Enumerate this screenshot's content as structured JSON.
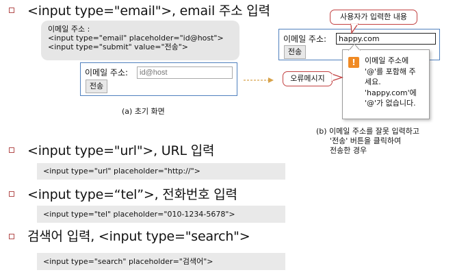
{
  "sections": [
    {
      "heading": "<input type=\"email\">, email 주소 입력"
    },
    {
      "heading": "<input type=\"url\">, URL 입력",
      "code": "<input type=\"url\" placeholder=\"http://\">"
    },
    {
      "heading": "<input type=“tel”>, 전화번호 입력",
      "code": "<input type=\"tel\" placeholder=\"010-1234-5678\">"
    },
    {
      "heading": "검색어 입력, <input type=\"search\">",
      "code": "<input type=\"search\" placeholder=\"검색어\">"
    }
  ],
  "email_code": {
    "lines": [
      "이메일 주소 :",
      "<input type=\"email\" placeholder=\"id@host\">",
      "<input type=\"submit\" value=\"전송\">"
    ]
  },
  "demo_initial": {
    "label": "이메일 주소:",
    "placeholder": "id@host",
    "button": "전송",
    "caption": "(a) 초기 화면"
  },
  "demo_error": {
    "label": "이메일 주소:",
    "value": "happy.com",
    "button": "전송",
    "callout_user_input": "사용자가 입력한 내용",
    "callout_error": "오류메시지",
    "tooltip_lines": [
      "이메일 주소에",
      "'@'를 포함해 주",
      "세요.",
      "'happy.com'에",
      "'@'가 없습니다."
    ],
    "caption_lines": [
      "(b) 이메일 주소를 잘못 입력하고",
      "'전송' 버튼을 클릭하여",
      "전송한 경우"
    ]
  },
  "colors": {
    "bullet": "#b24a4a",
    "panel_border": "#4e7fbd",
    "callout_border": "#c24040",
    "arrow": "#d7a24a",
    "warning": "#f08a24"
  }
}
